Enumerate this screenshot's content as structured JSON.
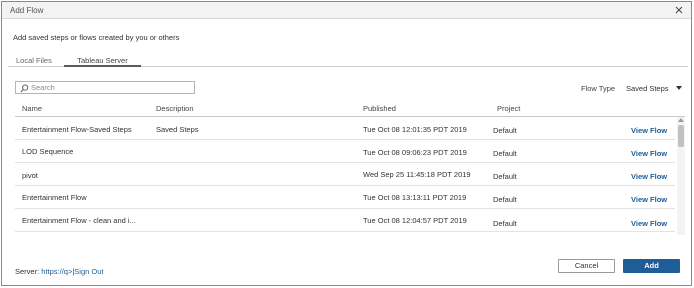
{
  "dialog": {
    "title": "Add Flow",
    "subtitle": "Add saved steps or flows created by you or others"
  },
  "tabs": [
    {
      "label": "Local Files",
      "active": false
    },
    {
      "label": "Tableau Server",
      "active": true
    }
  ],
  "search": {
    "placeholder": "Search",
    "value": ""
  },
  "filter": {
    "label": "Flow Type",
    "selected": "Saved Steps"
  },
  "table": {
    "columns": [
      "Name",
      "Description",
      "Published",
      "Project"
    ],
    "rows": [
      {
        "name": "Entertainment Flow-Saved Steps",
        "description": "Saved Steps",
        "published": "Tue Oct 08 12:01:35 PDT 2019",
        "project": "Default",
        "action": "View Flow"
      },
      {
        "name": "LOD Sequence",
        "description": "",
        "published": "Tue Oct 08 09:06:23 PDT 2019",
        "project": "Default",
        "action": "View Flow"
      },
      {
        "name": "pivot",
        "description": "",
        "published": "Wed Sep 25 11:45:18 PDT 2019",
        "project": "Default",
        "action": "View Flow"
      },
      {
        "name": "Entertainment Flow",
        "description": "",
        "published": "Tue Oct 08 13:13:11 PDT 2019",
        "project": "Default",
        "action": "View Flow"
      },
      {
        "name": "Entertainment Flow - clean and i...",
        "description": "",
        "published": "Tue Oct 08 12:04:57 PDT 2019",
        "project": "Default",
        "action": "View Flow"
      }
    ]
  },
  "footer": {
    "server_label": "Server:",
    "server_url": "https://q>",
    "separator": "|",
    "sign_out": "Sign Out",
    "cancel_label": "Cancel",
    "add_label": "Add"
  },
  "colors": {
    "accent": "#1f5d99"
  },
  "icons": {
    "close": "close-icon",
    "search": "search-icon",
    "dropdown": "chevron-down-icon"
  }
}
